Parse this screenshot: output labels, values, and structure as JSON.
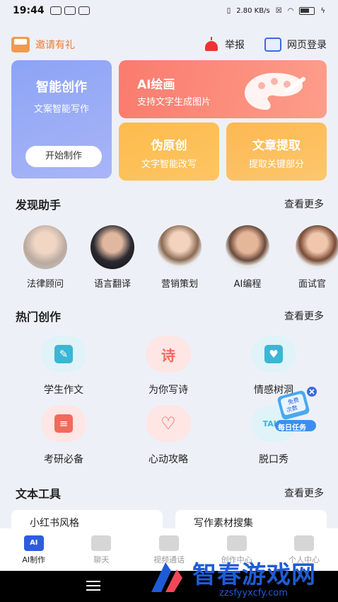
{
  "status": {
    "time": "19:44",
    "speed": "2.80 KB/s"
  },
  "topbar": {
    "invite": "邀请有礼",
    "report": "举报",
    "web_login": "网页登录"
  },
  "cards": {
    "smart": {
      "title": "智能创作",
      "subtitle": "文案智能写作",
      "button": "开始制作"
    },
    "ai_draw": {
      "title": "AI绘画",
      "subtitle": "支持文字生成图片"
    },
    "pseudo": {
      "title": "伪原创",
      "subtitle": "文字智能改写"
    },
    "extract": {
      "title": "文章提取",
      "subtitle": "提取关键部分"
    }
  },
  "discover": {
    "title": "发现助手",
    "more": "查看更多",
    "items": [
      {
        "label": "法律顾问"
      },
      {
        "label": "语言翻译"
      },
      {
        "label": "营销策划"
      },
      {
        "label": "AI编程"
      },
      {
        "label": "面试官"
      }
    ]
  },
  "hot": {
    "title": "热门创作",
    "more": "查看更多",
    "items": [
      {
        "label": "学生作文",
        "glyph": "✎"
      },
      {
        "label": "为你写诗",
        "glyph": "诗"
      },
      {
        "label": "情感树洞",
        "glyph": "♥"
      },
      {
        "label": "考研必备",
        "glyph": "≡"
      },
      {
        "label": "心动攻略",
        "glyph": "♡"
      },
      {
        "label": "脱口秀",
        "glyph": "TALK"
      }
    ]
  },
  "tools": {
    "title": "文本工具",
    "more": "查看更多",
    "items": [
      {
        "label": "小红书风格"
      },
      {
        "label": "写作素材搜集"
      }
    ]
  },
  "float_badge": {
    "line1": "免费",
    "line2": "次数",
    "task": "每日任务"
  },
  "nav": [
    {
      "label": "AI制作",
      "icon": "AI"
    },
    {
      "label": "聊天"
    },
    {
      "label": "视频通话"
    },
    {
      "label": "创作中心"
    },
    {
      "label": "个人中心"
    }
  ],
  "watermark": {
    "text": "智春游戏网",
    "url": "zzsfyyxcfy.com"
  },
  "colors": {
    "accent": "#2e5be0",
    "orange": "#f07a2e",
    "coral": "#fa7b6e",
    "amber": "#fdbb4c"
  }
}
